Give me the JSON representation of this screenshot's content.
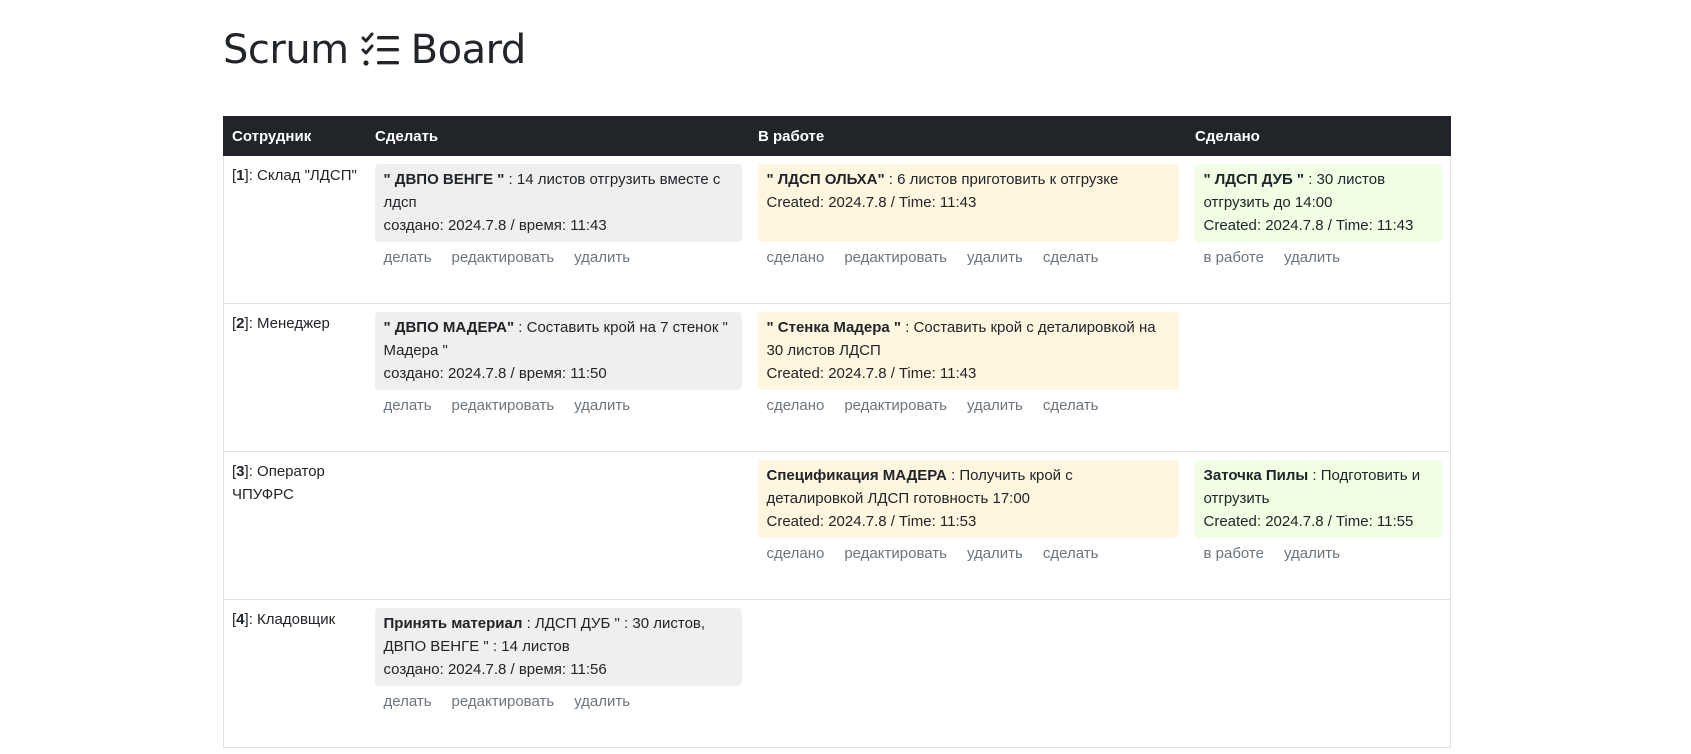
{
  "title": {
    "left": "Scrum",
    "right": "Board",
    "icon": "checklist-icon"
  },
  "columns": [
    "Сотрудник",
    "Сделать",
    "В работе",
    "Сделано"
  ],
  "rows": [
    {
      "employee": {
        "num": "1",
        "name": ": Склад \"ЛДСП\""
      },
      "todo": {
        "name": "\" ДВПО ВЕНГЕ \"",
        "desc": " : 14 листов отгрузить вместе с лдсп",
        "meta": "создано: 2024.7.8 / время: 11:43",
        "actions": [
          "делать",
          "редактировать",
          "удалить"
        ]
      },
      "work": {
        "name": "\" ЛДСП ОЛЬХА\"",
        "desc": " : 6 листов приготовить к отгрузке",
        "meta": "Created: 2024.7.8 / Time: 11:43",
        "actions": [
          "сделано",
          "редактировать",
          "удалить",
          "сделать"
        ]
      },
      "done": {
        "name": "\" ЛДСП ДУБ \"",
        "desc": " : 30 листов отгрузить до 14:00",
        "meta": "Created: 2024.7.8 / Time: 11:43",
        "actions": [
          "в работе",
          "удалить"
        ]
      }
    },
    {
      "employee": {
        "num": "2",
        "name": ": Менеджер"
      },
      "todo": {
        "name": "\" ДВПО МАДЕРА\"",
        "desc": " : Составить крой на 7 стенок \" Мадера \"",
        "meta": "создано: 2024.7.8 / время: 11:50",
        "actions": [
          "делать",
          "редактировать",
          "удалить"
        ]
      },
      "work": {
        "name": "\" Стенка Мадера \"",
        "desc": " : Составить крой с деталировкой на 30 листов ЛДСП",
        "meta": "Created: 2024.7.8 / Time: 11:43",
        "actions": [
          "сделано",
          "редактировать",
          "удалить",
          "сделать"
        ]
      },
      "done": null
    },
    {
      "employee": {
        "num": "3",
        "name": ": Оператор ЧПУФРС"
      },
      "todo": null,
      "work": {
        "name": "Спецификация МАДЕРА",
        "desc": " : Получить крой с деталировкой ЛДСП готовность 17:00",
        "meta": "Created: 2024.7.8 / Time: 11:53",
        "actions": [
          "сделано",
          "редактировать",
          "удалить",
          "сделать"
        ]
      },
      "done": {
        "name": "Заточка Пилы",
        "desc": " : Подготовить и отгрузить",
        "meta": "Created: 2024.7.8 / Time: 11:55",
        "actions": [
          "в работе",
          "удалить"
        ]
      }
    },
    {
      "employee": {
        "num": "4",
        "name": ": Кладовщик"
      },
      "todo": {
        "name": "Принять материал",
        "desc": " : ЛДСП ДУБ \" : 30 листов, ДВПО ВЕНГЕ \" : 14 листов",
        "meta": "создано: 2024.7.8 / время: 11:56",
        "actions": [
          "делать",
          "редактировать",
          "удалить"
        ]
      },
      "work": null,
      "done": null
    }
  ],
  "colors": {
    "header_bg": "#212529",
    "todo_bg": "#efefef",
    "work_bg": "#fff6e0",
    "done_bg": "#f0ffe3",
    "action_text": "#6c757d"
  }
}
